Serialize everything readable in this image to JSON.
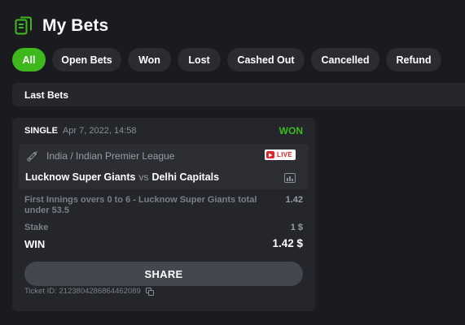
{
  "header": {
    "title": "My Bets",
    "icon": "receipt-icon"
  },
  "filters": [
    "All",
    "Open Bets",
    "Won",
    "Lost",
    "Cashed Out",
    "Cancelled",
    "Refund"
  ],
  "active_filter": "All",
  "section": {
    "title": "Last Bets"
  },
  "bet": {
    "type": "SINGLE",
    "date": "Apr 7, 2022, 14:58",
    "result": "WON",
    "event": {
      "league": "India / Indian Premier League",
      "live_label": "LIVE",
      "home_team": "Lucknow Super Giants",
      "vs": "vs",
      "away_team": "Delhi Capitals"
    },
    "selection": "First Innings overs 0 to 6 - Lucknow Super Giants total under 53.5",
    "odds": "1.42",
    "stake_label": "Stake",
    "stake_value": "1 $",
    "win_label": "WIN",
    "win_value": "1.42 $",
    "share_label": "SHARE",
    "ticket_id": "Ticket ID: 2123804286864462089"
  },
  "colors": {
    "accent_green": "#3fb81d",
    "background": "#1a1b1f",
    "card": "#24262b",
    "live_red": "#e4222b"
  }
}
